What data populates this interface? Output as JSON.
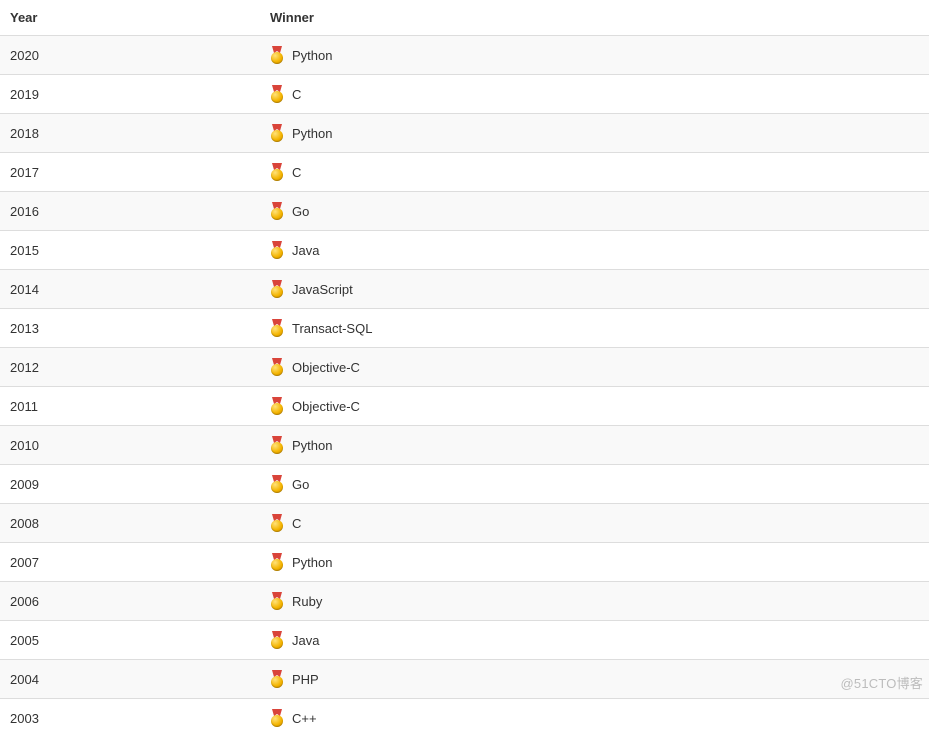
{
  "table": {
    "headers": {
      "year": "Year",
      "winner": "Winner"
    },
    "rows": [
      {
        "year": "2020",
        "winner": "Python"
      },
      {
        "year": "2019",
        "winner": "C"
      },
      {
        "year": "2018",
        "winner": "Python"
      },
      {
        "year": "2017",
        "winner": "C"
      },
      {
        "year": "2016",
        "winner": "Go"
      },
      {
        "year": "2015",
        "winner": "Java"
      },
      {
        "year": "2014",
        "winner": "JavaScript"
      },
      {
        "year": "2013",
        "winner": "Transact-SQL"
      },
      {
        "year": "2012",
        "winner": "Objective-C"
      },
      {
        "year": "2011",
        "winner": "Objective-C"
      },
      {
        "year": "2010",
        "winner": "Python"
      },
      {
        "year": "2009",
        "winner": "Go"
      },
      {
        "year": "2008",
        "winner": "C"
      },
      {
        "year": "2007",
        "winner": "Python"
      },
      {
        "year": "2006",
        "winner": "Ruby"
      },
      {
        "year": "2005",
        "winner": "Java"
      },
      {
        "year": "2004",
        "winner": "PHP"
      },
      {
        "year": "2003",
        "winner": "C++"
      }
    ]
  },
  "watermark": "@51CTO博客"
}
